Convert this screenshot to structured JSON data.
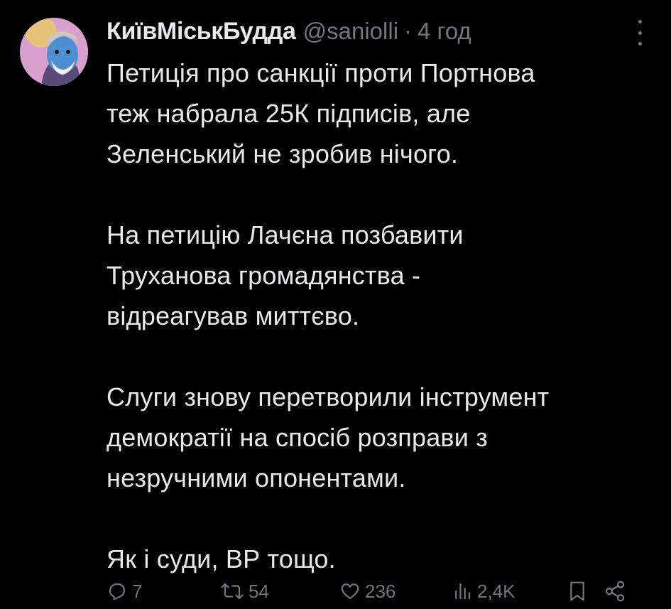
{
  "tweet": {
    "display_name": "КиївМіськБудда",
    "handle": "@saniolli",
    "separator": "·",
    "time": "4 год",
    "paragraphs": [
      "Петиція про санкції проти Портнова\nтеж набрала 25К підписів, але\nЗеленський не зробив нічого.",
      "На петицію Лачєна позбавити\nТруханова громадянства -\nвідреагував миттєво.",
      "Слуги знову перетворили інструмент\nдемократії на спосіб розправи з\nнезручними опонентами.",
      "Як і суди, ВР тощо."
    ],
    "actions": {
      "replies": "7",
      "retweets": "54",
      "likes": "236",
      "views": "2,4K"
    }
  },
  "icons": {
    "more": "more-vertical-icon",
    "reply": "reply-icon",
    "retweet": "retweet-icon",
    "like": "heart-icon",
    "views": "views-icon",
    "bookmark": "bookmark-icon",
    "share": "share-icon"
  },
  "colors": {
    "background": "#000000",
    "text": "#e7e9ea",
    "muted": "#71767b"
  }
}
